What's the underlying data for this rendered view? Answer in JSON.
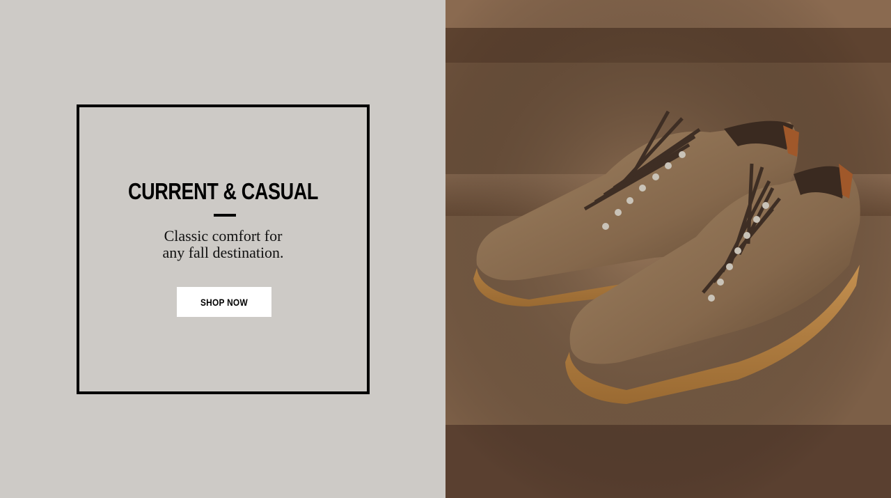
{
  "promo": {
    "title": "CURRENT & CASUAL",
    "subtitle_line1": "Classic comfort for",
    "subtitle_line2": "any fall destination.",
    "cta_label": "SHOP NOW"
  },
  "colors": {
    "panel_bg": "#cdcac6",
    "frame": "#000000",
    "button_bg": "#ffffff"
  }
}
